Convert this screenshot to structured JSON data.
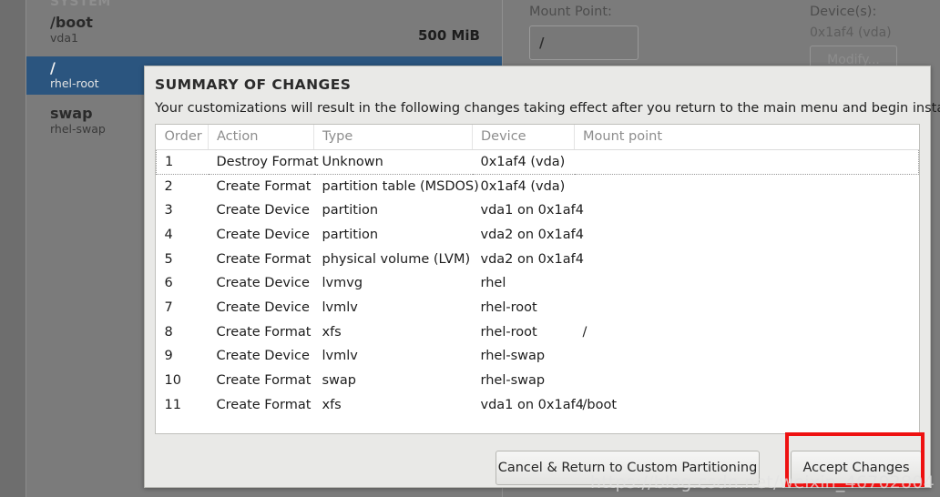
{
  "background": {
    "section_header": "SYSTEM",
    "devices": [
      {
        "name": "/boot",
        "sub": "vda1",
        "size": "500 MiB",
        "selected": false
      },
      {
        "name": "/",
        "sub": "rhel-root",
        "size": "",
        "selected": true
      },
      {
        "name": "swap",
        "sub": "rhel-swap",
        "size": "",
        "selected": false
      }
    ],
    "config": {
      "mount_point_label": "Mount Point:",
      "mount_point_value": "/",
      "devices_label": "Device(s):",
      "devices_value": "0x1af4 (vda)",
      "modify_button": "Modify..."
    }
  },
  "dialog": {
    "title": "SUMMARY OF CHANGES",
    "description": "Your customizations will result in the following changes taking effect after you return to the main menu and begin installation:",
    "table": {
      "columns": [
        "Order",
        "Action",
        "Type",
        "Device",
        "Mount point"
      ],
      "rows": [
        {
          "order": "1",
          "action": "Destroy Format",
          "action_kind": "destroy",
          "type": "Unknown",
          "device": "0x1af4 (vda)",
          "mount": "",
          "focused": true
        },
        {
          "order": "2",
          "action": "Create Format",
          "action_kind": "create",
          "type": "partition table (MSDOS)",
          "device": "0x1af4 (vda)",
          "mount": "",
          "focused": false
        },
        {
          "order": "3",
          "action": "Create Device",
          "action_kind": "create",
          "type": "partition",
          "device": "vda1 on 0x1af4",
          "mount": "",
          "focused": false
        },
        {
          "order": "4",
          "action": "Create Device",
          "action_kind": "create",
          "type": "partition",
          "device": "vda2 on 0x1af4",
          "mount": "",
          "focused": false
        },
        {
          "order": "5",
          "action": "Create Format",
          "action_kind": "create",
          "type": "physical volume (LVM)",
          "device": "vda2 on 0x1af4",
          "mount": "",
          "focused": false
        },
        {
          "order": "6",
          "action": "Create Device",
          "action_kind": "create",
          "type": "lvmvg",
          "device": "rhel",
          "mount": "",
          "focused": false
        },
        {
          "order": "7",
          "action": "Create Device",
          "action_kind": "create",
          "type": "lvmlv",
          "device": "rhel-root",
          "mount": "",
          "focused": false
        },
        {
          "order": "8",
          "action": "Create Format",
          "action_kind": "create",
          "type": "xfs",
          "device": "rhel-root",
          "mount": "/",
          "focused": false
        },
        {
          "order": "9",
          "action": "Create Device",
          "action_kind": "create",
          "type": "lvmlv",
          "device": "rhel-swap",
          "mount": "",
          "focused": false
        },
        {
          "order": "10",
          "action": "Create Format",
          "action_kind": "create",
          "type": "swap",
          "device": "rhel-swap",
          "mount": "",
          "focused": false
        },
        {
          "order": "11",
          "action": "Create Format",
          "action_kind": "create",
          "type": "xfs",
          "device": "vda1 on 0x1af4",
          "mount": "/boot",
          "focused": false
        }
      ]
    },
    "buttons": {
      "cancel": "Cancel & Return to Custom Partitioning",
      "accept": "Accept Changes"
    }
  },
  "annotation": {
    "highlight_color": "#ee1111"
  },
  "watermark": {
    "text": "https://blog.csdn.net/weixin_46702804"
  }
}
